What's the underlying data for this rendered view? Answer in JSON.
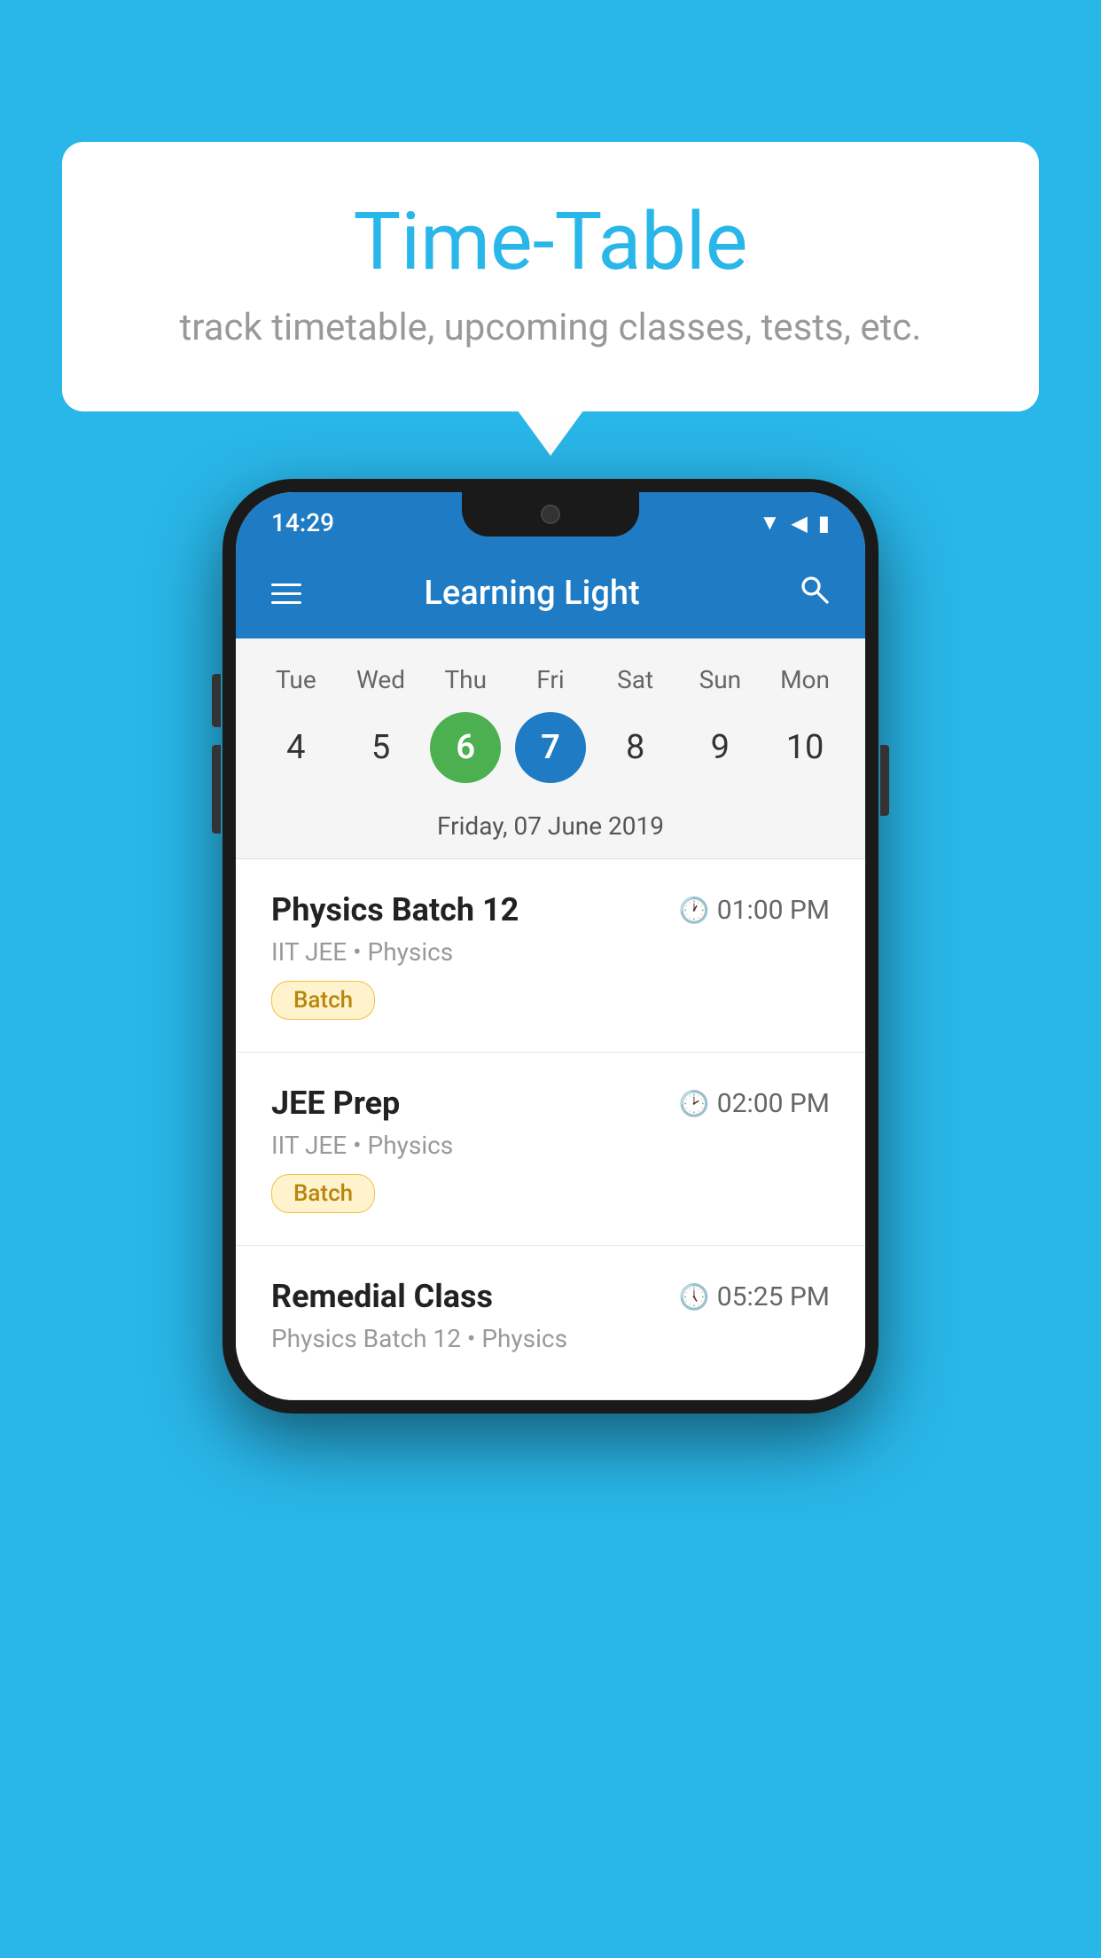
{
  "page": {
    "background_color": "#29b6e8"
  },
  "speech_bubble": {
    "title": "Time-Table",
    "subtitle": "track timetable, upcoming classes, tests, etc."
  },
  "phone": {
    "status_bar": {
      "time": "14:29"
    },
    "app_bar": {
      "title": "Learning Light",
      "search_label": "search"
    },
    "calendar": {
      "days": [
        "Tue",
        "Wed",
        "Thu",
        "Fri",
        "Sat",
        "Sun",
        "Mon"
      ],
      "dates": [
        4,
        5,
        6,
        7,
        8,
        9,
        10
      ],
      "today_index": 2,
      "selected_index": 3,
      "selected_date_label": "Friday, 07 June 2019"
    },
    "classes": [
      {
        "name": "Physics Batch 12",
        "time": "01:00 PM",
        "meta": "IIT JEE • Physics",
        "badge": "Batch"
      },
      {
        "name": "JEE Prep",
        "time": "02:00 PM",
        "meta": "IIT JEE • Physics",
        "badge": "Batch"
      },
      {
        "name": "Remedial Class",
        "time": "05:25 PM",
        "meta": "Physics Batch 12 • Physics",
        "badge": null
      }
    ]
  }
}
